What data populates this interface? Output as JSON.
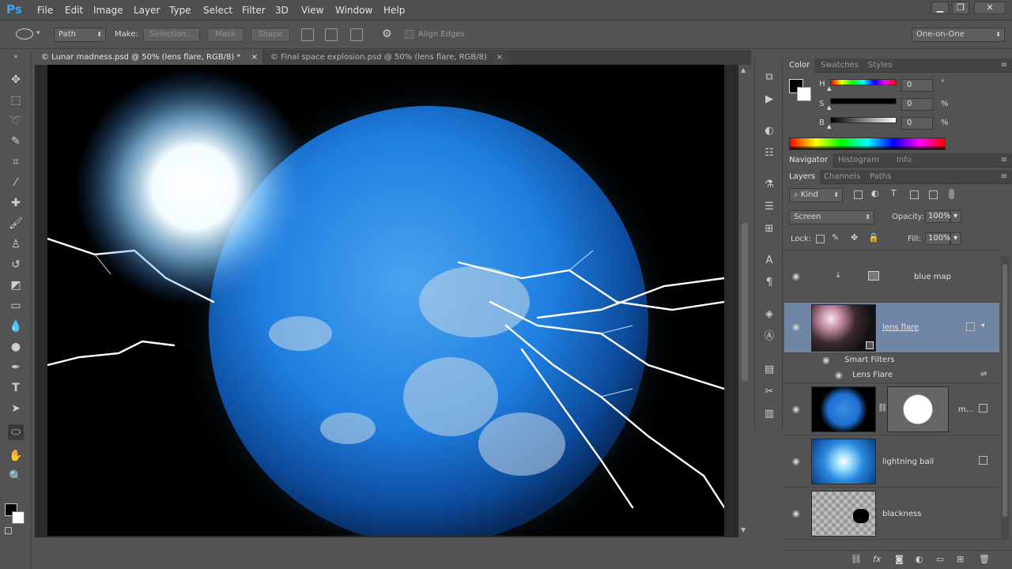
{
  "app": {
    "logo": "Ps"
  },
  "menu": [
    "File",
    "Edit",
    "Image",
    "Layer",
    "Type",
    "Select",
    "Filter",
    "3D",
    "View",
    "Window",
    "Help"
  ],
  "window_controls": {
    "minimize": "▁",
    "restore": "❐",
    "close": "✕"
  },
  "options": {
    "mode": "Path",
    "make_label": "Make:",
    "selection": "Selection...",
    "mask": "Mask",
    "shape": "Shape",
    "align_edges": "Align Edges",
    "workspace": "One-on-One"
  },
  "tabs": [
    {
      "label": "© Lunar madness.psd @ 50% (lens flare, RGB/8) *",
      "close": "×"
    },
    {
      "label": "© Final space explosion.psd @ 50% (lens flare, RGB/8)",
      "close": "×"
    }
  ],
  "color_panel": {
    "tabs": [
      "Color",
      "Swatches",
      "Styles"
    ],
    "channels": [
      {
        "label": "H",
        "value": "0",
        "unit": "°"
      },
      {
        "label": "S",
        "value": "0",
        "unit": "%"
      },
      {
        "label": "B",
        "value": "0",
        "unit": "%"
      }
    ]
  },
  "nav_panel": {
    "tabs": [
      "Navigator",
      "Histogram",
      "Info"
    ]
  },
  "layers_panel": {
    "tabs": [
      "Layers",
      "Channels",
      "Paths"
    ],
    "filter_kind": "Kind",
    "blend_mode": "Screen",
    "opacity_label": "Opacity:",
    "opacity": "100%",
    "lock_label": "Lock:",
    "fill_label": "Fill:",
    "fill": "100%",
    "layers": [
      {
        "name": "blue map"
      },
      {
        "name": "lens flare"
      },
      {
        "name": "Smart Filters"
      },
      {
        "name": "Lens Flare"
      },
      {
        "name": "m..."
      },
      {
        "name": "lightning ball"
      },
      {
        "name": "blackness"
      }
    ],
    "footer_icons": [
      "link-icon",
      "fx-icon",
      "mask-icon",
      "adjustment-icon",
      "group-icon",
      "new-layer-icon",
      "trash-icon"
    ]
  },
  "colors": {
    "accent_blue": "#1f7fe0",
    "selected_layer": "#7086a6",
    "panel_bg": "#535353"
  }
}
